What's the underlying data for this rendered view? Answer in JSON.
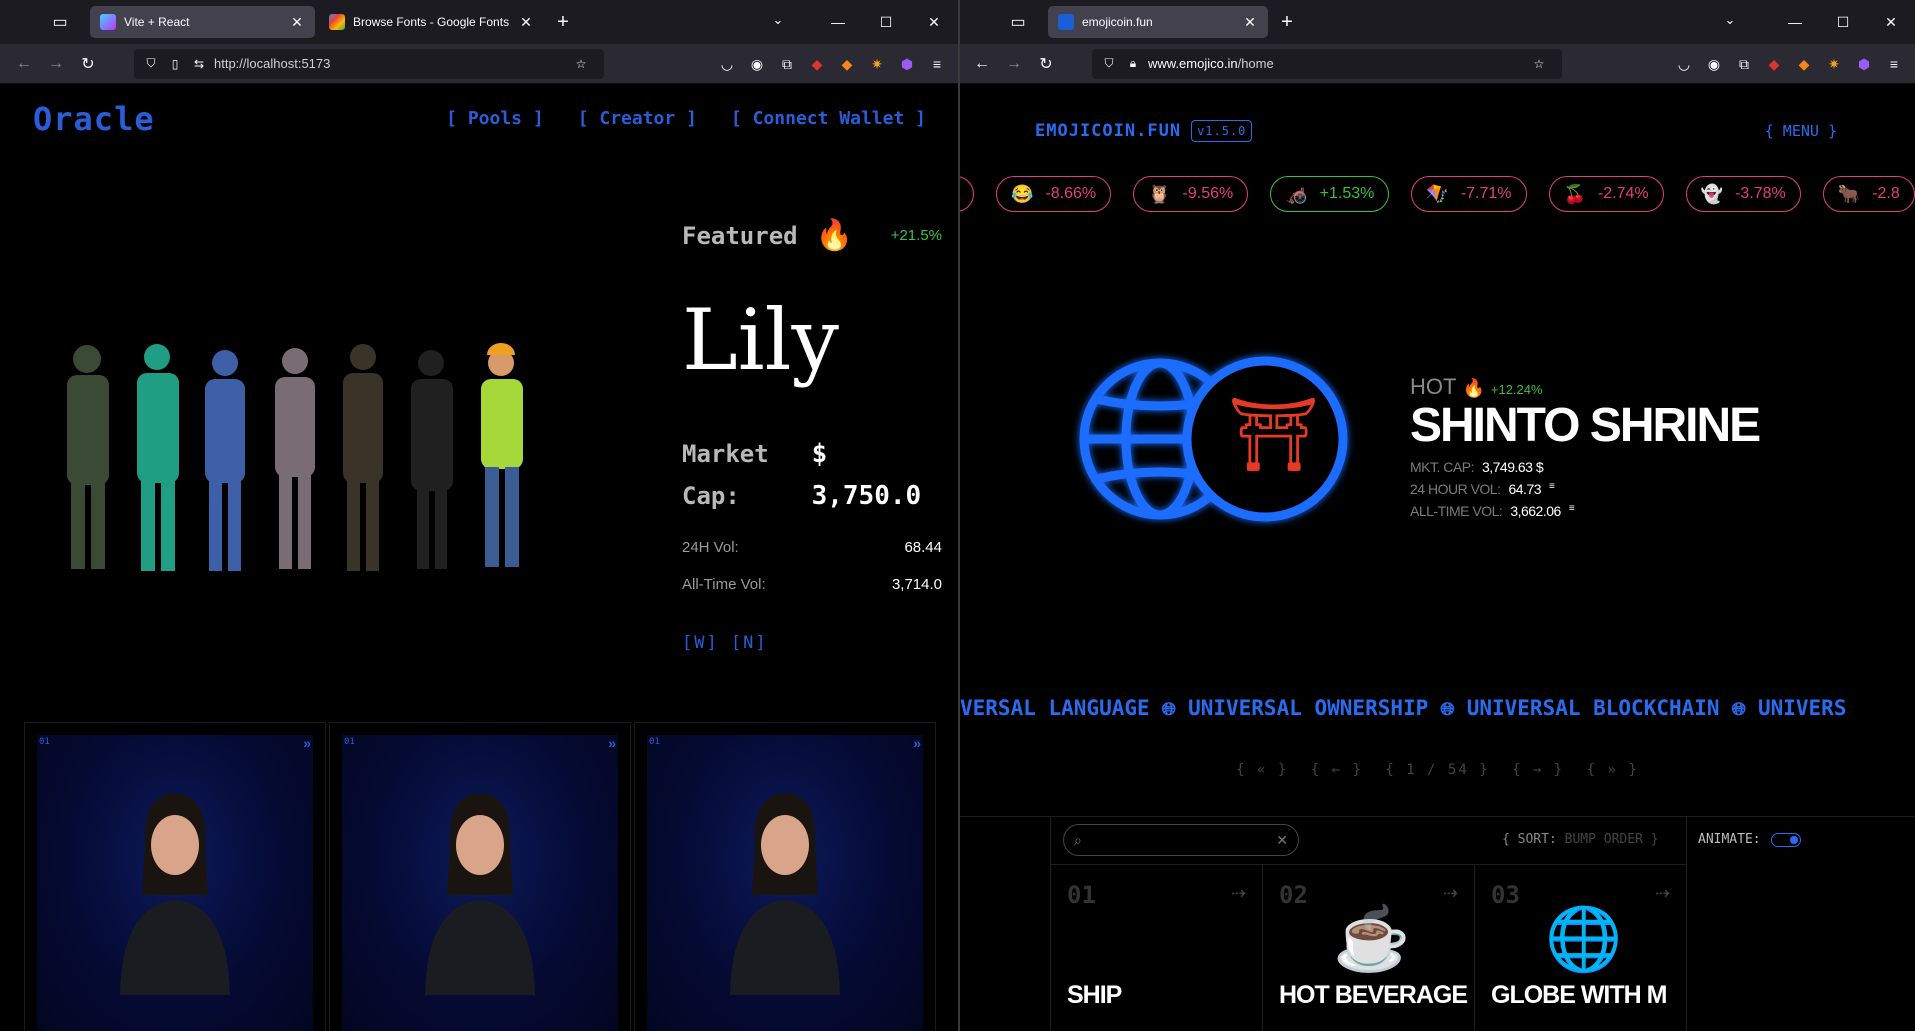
{
  "left_window": {
    "tabs": [
      {
        "label": "Vite + React",
        "active": true
      },
      {
        "label": "Browse Fonts - Google Fonts",
        "active": false
      }
    ],
    "url": "http://localhost:5173",
    "app": {
      "logo": "Oracle",
      "nav": [
        "[ Pools ]",
        "[ Creator ]",
        "[ Connect Wallet ]"
      ],
      "featured": {
        "label": "Featured",
        "icon": "🔥",
        "change": "+21.5%",
        "name": "Lily",
        "market_cap_label": "Market Cap:",
        "market_cap_value": "$ 3,750.0",
        "vol_24h_label": "24H Vol:",
        "vol_24h_value": "68.44",
        "all_time_vol_label": "All-Time Vol:",
        "all_time_vol_value": "3,714.0",
        "links": "[W] [N]"
      },
      "cards": [
        {
          "num": "01",
          "arrow": "»"
        },
        {
          "num": "01",
          "arrow": "»"
        },
        {
          "num": "01",
          "arrow": "»"
        }
      ]
    }
  },
  "right_window": {
    "tabs": [
      {
        "label": "emojicoin.fun",
        "active": true
      }
    ],
    "url_host": "www.emojico.in",
    "url_path": "/home",
    "app": {
      "logo": "EMOJICOIN.FUN",
      "version": "v1.5.0",
      "menu": "{ MENU }",
      "ticker": [
        {
          "emoji": "",
          "change": "",
          "dir": "down"
        },
        {
          "emoji": "😂",
          "change": "-8.66%",
          "dir": "down"
        },
        {
          "emoji": "🦉",
          "change": "-9.56%",
          "dir": "down"
        },
        {
          "emoji": "🦽",
          "change": "+1.53%",
          "dir": "up"
        },
        {
          "emoji": "🪁",
          "change": "-7.71%",
          "dir": "down"
        },
        {
          "emoji": "🍒",
          "change": "-2.74%",
          "dir": "down"
        },
        {
          "emoji": "👻",
          "change": "-3.78%",
          "dir": "down"
        },
        {
          "emoji": "🐂",
          "change": "-2.8",
          "dir": "down"
        }
      ],
      "hot": {
        "label": "HOT",
        "icon": "🔥",
        "change": "+12.24%",
        "name": "SHINTO SHRINE",
        "emoji": "⛩",
        "mkt_cap_label": "MKT. CAP:",
        "mkt_cap_value": "3,749.63 $",
        "vol_24h_label": "24 HOUR VOL:",
        "vol_24h_value": "64.73",
        "all_time_label": "ALL-TIME VOL:",
        "all_time_value": "3,662.06"
      },
      "marquee": [
        "VERSAL LANGUAGE",
        "UNIVERSAL OWNERSHIP",
        "UNIVERSAL BLOCKCHAIN",
        "UNIVERS"
      ],
      "pager": {
        "first": "{ « }",
        "prev": "{ ← }",
        "current": "{ 1 / 54 }",
        "next": "{ → }",
        "last": "{ » }"
      },
      "sort_label": "{ SORT:",
      "sort_value": "BUMP ORDER }",
      "animate_label": "ANIMATE:",
      "animate_on": true,
      "tiles": [
        {
          "num": "01",
          "emoji": "🛳",
          "name": "SHIP"
        },
        {
          "num": "02",
          "emoji": "☕",
          "name": "HOT BEVERAGE"
        },
        {
          "num": "03",
          "emoji": "🌐",
          "name": "GLOBE WITH M"
        }
      ]
    }
  },
  "colors": {
    "oracle_blue": "#2a5dd8",
    "emoji_blue": "#2a6cf0",
    "up_green": "#3cbf3c",
    "down_pink": "#e0407a"
  }
}
